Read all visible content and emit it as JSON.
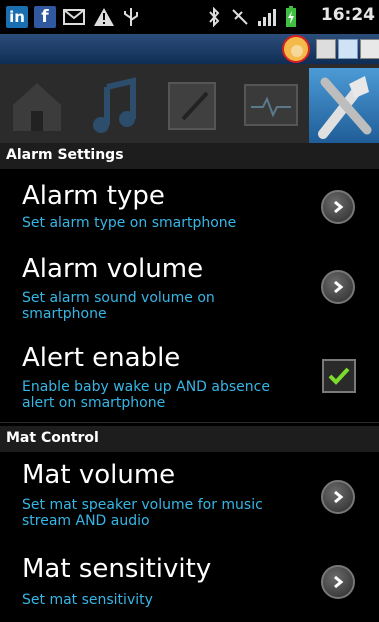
{
  "status_bar": {
    "time": "16:24",
    "icons": [
      "linkedin-icon",
      "facebook-icon",
      "mail-icon",
      "warning-icon",
      "usb-icon",
      "bluetooth-icon",
      "mute-icon",
      "signal-icon",
      "battery-icon"
    ]
  },
  "action_bar": {
    "icons": [
      "baby-app-icon",
      "notification-icon",
      "media-icon",
      "text-icon"
    ]
  },
  "tabs": [
    "home-tab",
    "music-tab",
    "notes-tab",
    "monitor-tab",
    "settings-tab"
  ],
  "sections": {
    "alarm": "Alarm Settings",
    "mat": "Mat Control"
  },
  "items": [
    {
      "title": "Alarm type",
      "sub": "Set alarm type on smartphone",
      "control": "chevron"
    },
    {
      "title": "Alarm volume",
      "sub": "Set alarm sound volume on smartphone",
      "control": "chevron"
    },
    {
      "title": "Alert enable",
      "sub": "Enable baby wake up AND absence alert on smartphone",
      "control": "checkbox",
      "checked": true
    },
    {
      "title": "Mat volume",
      "sub": "Set mat speaker volume for music stream AND audio",
      "control": "chevron"
    },
    {
      "title": "Mat sensitivity",
      "sub": "Set mat sensitivity",
      "control": "chevron"
    }
  ],
  "colors": {
    "accent": "#37b6e6",
    "action_bar": "#1b3f6b",
    "tab_active": "#3a86c8"
  }
}
